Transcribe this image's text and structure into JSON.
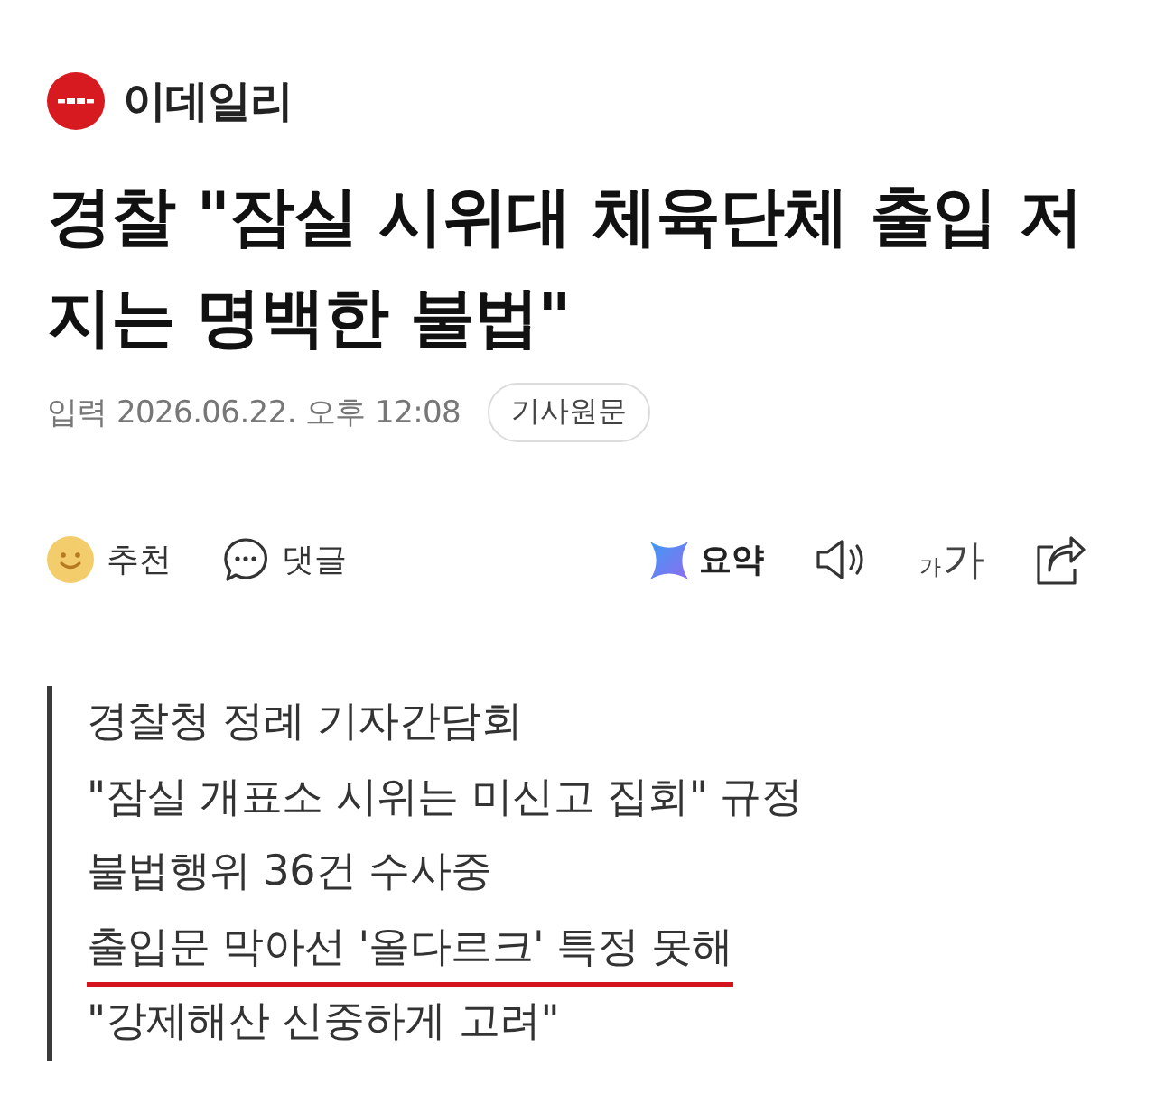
{
  "header": {
    "publisher": "이데일리"
  },
  "article": {
    "headline": "경찰 \"잠실 시위대 체육단체 출입 저지는 명백한 불법\"",
    "published": "입력 2026.06.22. 오후 12:08",
    "original_link": "기사원문"
  },
  "actions": [
    {
      "kind": "recommend",
      "label": "추천"
    },
    {
      "kind": "comment",
      "label": "댓글"
    }
  ],
  "tools": [
    {
      "kind": "summary",
      "label": "요약"
    },
    {
      "kind": "listen"
    },
    {
      "kind": "font_size",
      "small": "가",
      "large": "가"
    },
    {
      "kind": "share"
    }
  ],
  "summary": [
    {
      "text": "경찰청 정례 기자간담회",
      "highlighted": false
    },
    {
      "text": "\"잠실 개표소 시위는 미신고 집회\" 규정",
      "highlighted": false
    },
    {
      "text": "불법행위 36건 수사중",
      "highlighted": false
    },
    {
      "text": "출입문 막아선 '올다르크' 특정 못해",
      "highlighted": true
    },
    {
      "text": "\"강제해산 신중하게 고려\"",
      "highlighted": false
    }
  ]
}
